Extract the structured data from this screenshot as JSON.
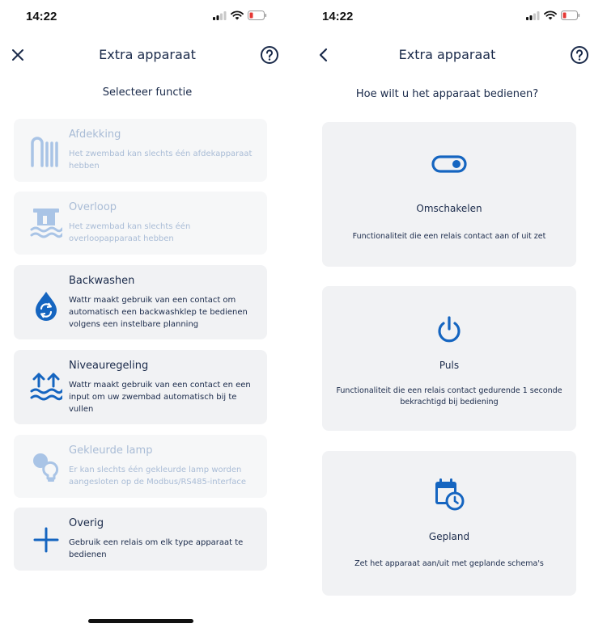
{
  "left_screen": {
    "status": {
      "time": "14:22"
    },
    "header": {
      "title": "Extra apparaat",
      "close_icon": "close-icon",
      "help_icon": "help-icon"
    },
    "subtitle": "Selecteer functie",
    "functions": [
      {
        "title": "Afdekking",
        "description": "Het zwembad kan slechts één afdekapparaat hebben",
        "icon": "pool-cover-icon",
        "enabled": false
      },
      {
        "title": "Overloop",
        "description": "Het zwembad kan slechts één overloopapparaat hebben",
        "icon": "overflow-icon",
        "enabled": false
      },
      {
        "title": "Backwashen",
        "description": "Wattr maakt gebruik van een contact om automatisch een backwashklep te bedienen volgens een instelbare planning",
        "icon": "backwash-icon",
        "enabled": true
      },
      {
        "title": "Niveauregeling",
        "description": "Wattr maakt gebruik van een contact en een input om uw zwembad automatisch bij te vullen",
        "icon": "level-control-icon",
        "enabled": true
      },
      {
        "title": "Gekleurde lamp",
        "description": "Er kan slechts één gekleurde lamp worden aangesloten op de Modbus/RS485-interface",
        "icon": "colored-lamp-icon",
        "enabled": false
      },
      {
        "title": "Overig",
        "description": "Gebruik een relais om elk type apparaat te bedienen",
        "icon": "plus-icon",
        "enabled": true
      }
    ]
  },
  "right_screen": {
    "status": {
      "time": "14:22"
    },
    "header": {
      "title": "Extra apparaat",
      "back_icon": "chevron-left-icon",
      "help_icon": "help-icon"
    },
    "subtitle": "Hoe wilt u het apparaat bedienen?",
    "options": [
      {
        "title": "Omschakelen",
        "description": "Functionaliteit die een relais contact aan of uit zet",
        "icon": "toggle-switch-icon"
      },
      {
        "title": "Puls",
        "description": "Functionaliteit die een relais contact gedurende 1 seconde bekrachtigd bij bediening",
        "icon": "power-icon"
      },
      {
        "title": "Gepland",
        "description": "Zet het apparaat aan/uit met geplande schema's",
        "icon": "calendar-clock-icon"
      }
    ]
  },
  "colors": {
    "primary": "#1565c0",
    "disabled": "#a9c4e6",
    "card_bg": "#f1f2f4",
    "text": "#1a2a4a"
  }
}
